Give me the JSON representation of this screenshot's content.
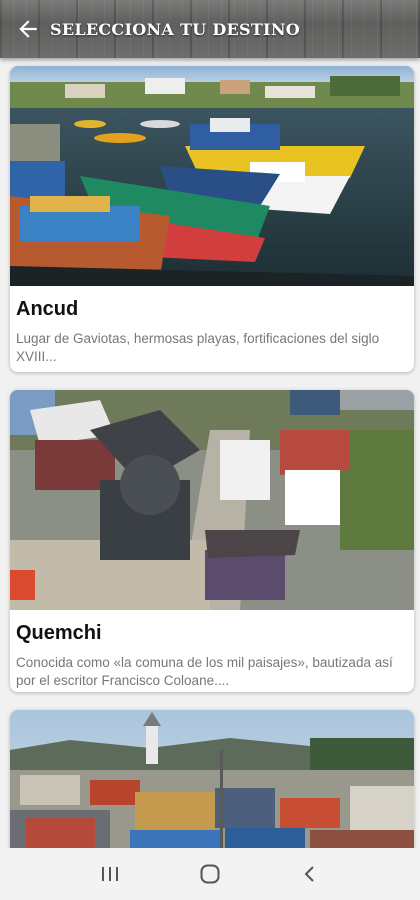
{
  "header": {
    "title": "SELECCIONA TU DESTINO",
    "back_icon": "arrow-left-icon"
  },
  "destinations": [
    {
      "name": "Ancud",
      "description": "Lugar de Gaviotas, hermosas playas, fortificaciones del siglo XVIII...",
      "image": "harbor-boats-photo"
    },
    {
      "name": "Quemchi",
      "description": "Conocida como «la comuna de los mil paisajes», bautizada así por el escritor Francisco Coloane....",
      "image": "aerial-houses-photo"
    },
    {
      "name": "",
      "description": "",
      "image": "town-church-photo"
    }
  ],
  "navigation": {
    "recents_icon": "recent-apps-icon",
    "home_icon": "home-circle-icon",
    "back_icon": "chevron-left-icon"
  }
}
